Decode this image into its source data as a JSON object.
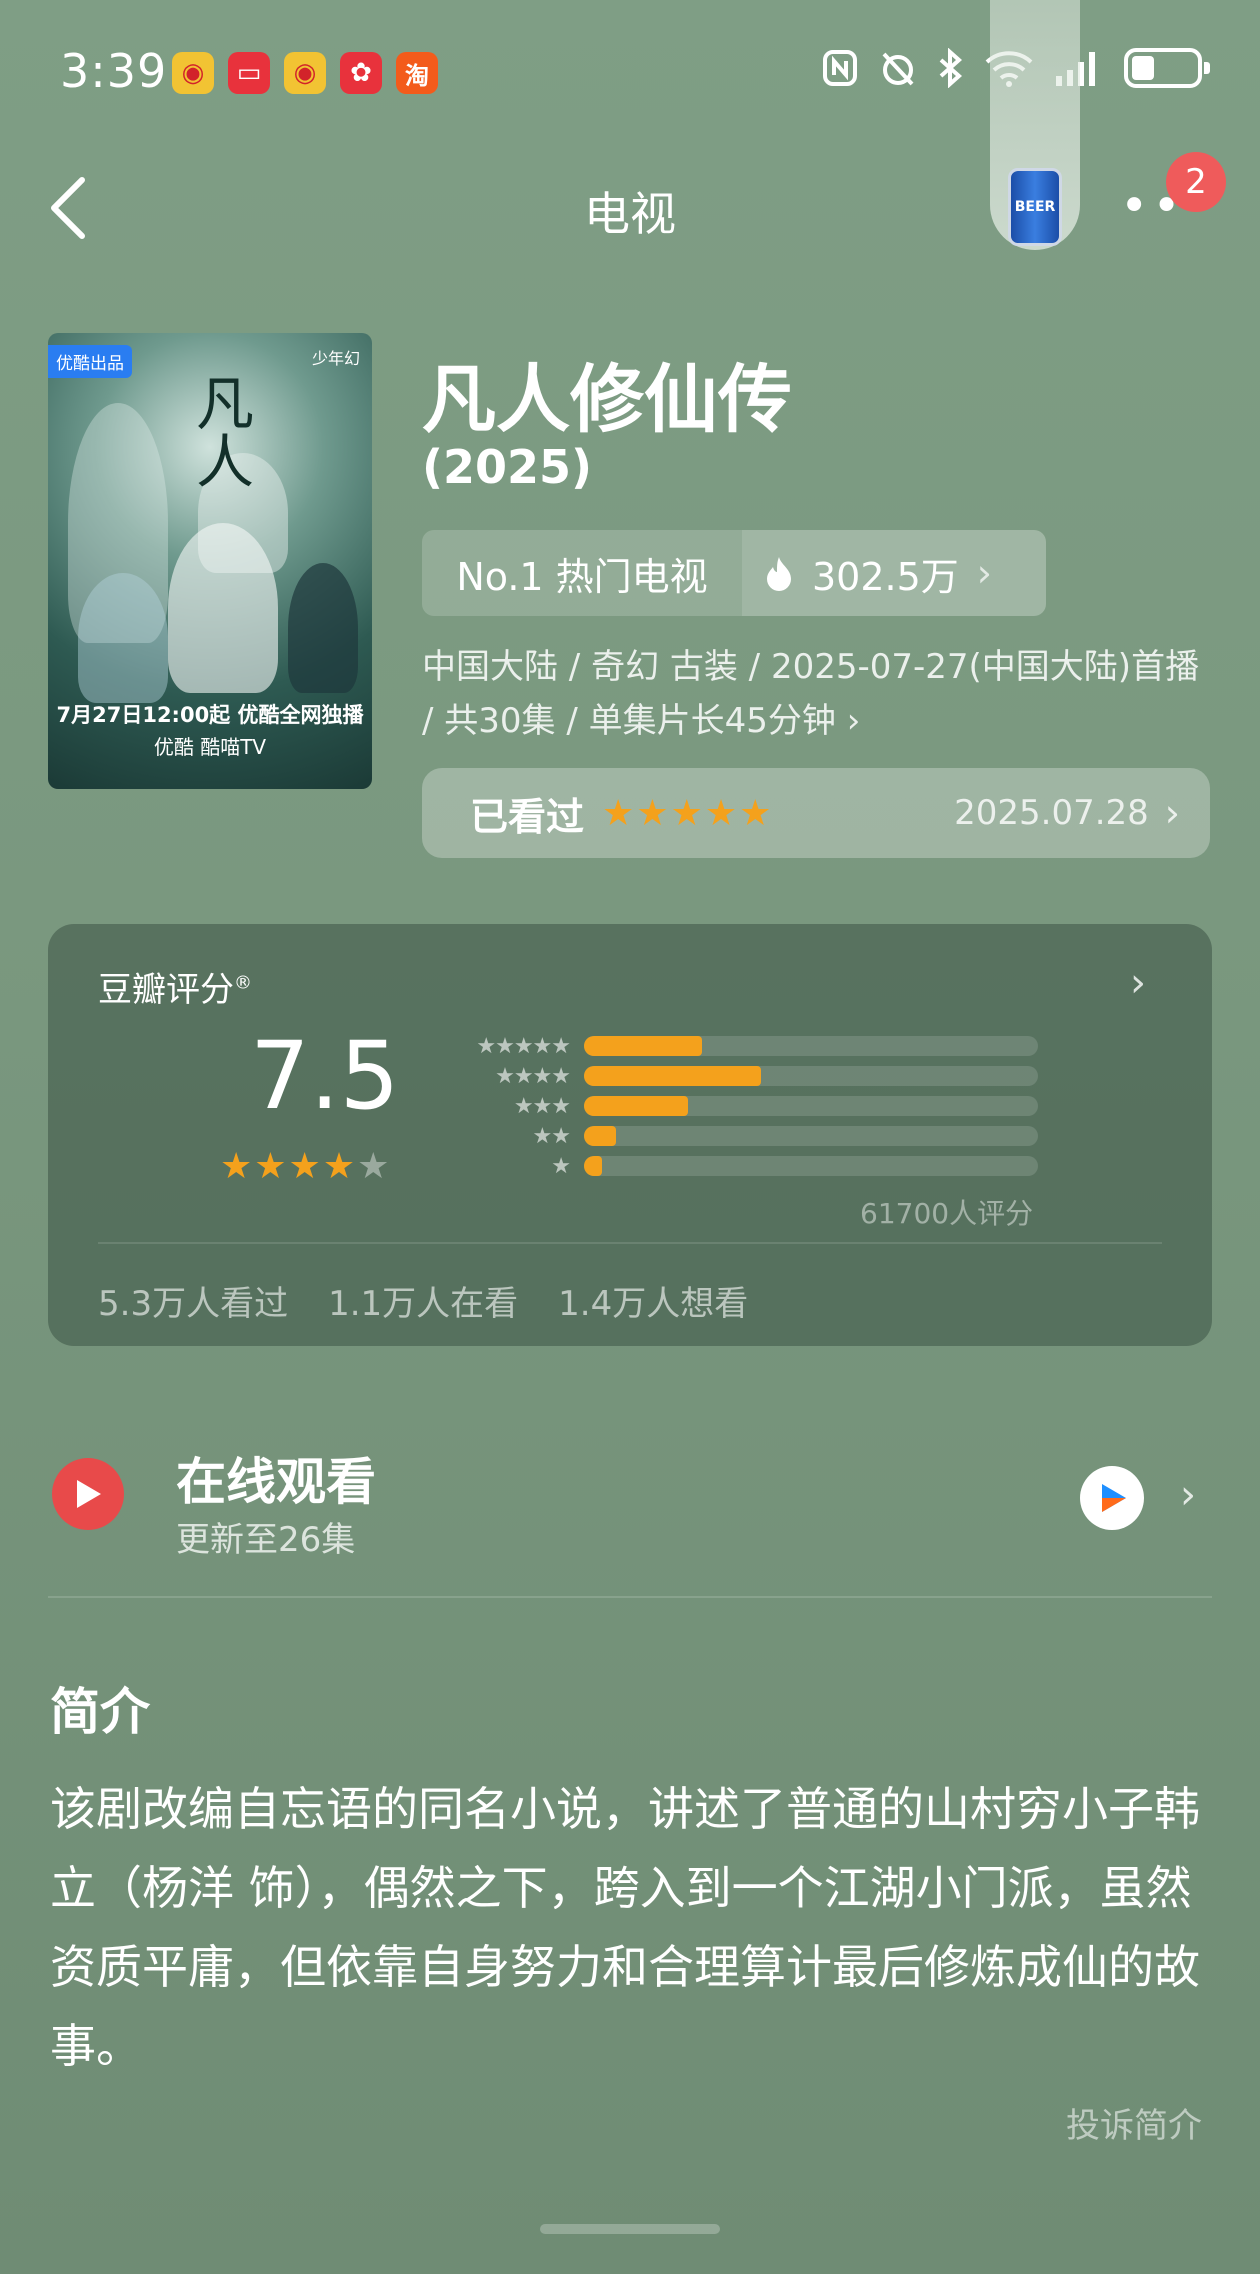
{
  "status_bar": {
    "time": "3:39",
    "apps": [
      {
        "name": "weibo-app-icon",
        "glyph": "微",
        "color": "#f2c333"
      },
      {
        "name": "red-book-app-icon",
        "glyph": "▢",
        "color": "#e8323c"
      },
      {
        "name": "weibo-app-icon-2",
        "glyph": "微",
        "color": "#f2c333"
      },
      {
        "name": "pinduoduo-app-icon",
        "glyph": "❖",
        "color": "#e8323c"
      },
      {
        "name": "taobao-app-icon",
        "glyph": "淘",
        "color": "#f35b1b"
      }
    ],
    "icons": [
      "nfc-icon",
      "alarm-icon",
      "bluetooth-icon",
      "wifi-icon",
      "signal-icon",
      "battery-icon"
    ]
  },
  "nav": {
    "title": "电视",
    "badge_count": "2"
  },
  "poster": {
    "tag": "优酷出品",
    "logo": "少年幻",
    "title": "凡人",
    "date_line": "7月27日12:00起 优酷全网独播",
    "platforms": "优酷  酷喵TV"
  },
  "show": {
    "title": "凡人修仙传",
    "year": "(2025)",
    "rank": "No.1 热门电视",
    "heat": "302.5万",
    "meta": "中国大陆 / 奇幻 古装 / 2025-07-27(中国大陆)首播 / 共30集 / 单集片长45分钟",
    "watched_label": "已看过",
    "watched_stars": "★★★★★",
    "watched_date": "2025.07.28"
  },
  "rating": {
    "title": "豆瓣评分",
    "score": "7.5",
    "stars_full": "★★★★",
    "stars_empty": "★",
    "distribution": [
      {
        "stars": "★★★★★",
        "fraction": 0.26
      },
      {
        "stars": "★★★★",
        "fraction": 0.39
      },
      {
        "stars": "★★★",
        "fraction": 0.23
      },
      {
        "stars": "★★",
        "fraction": 0.07
      },
      {
        "stars": "★",
        "fraction": 0.04
      }
    ],
    "count": "61700人评分",
    "watched": "5.3万人看过",
    "watching": "1.1万人在看",
    "want": "1.4万人想看"
  },
  "online": {
    "title": "在线观看",
    "subtitle": "更新至26集"
  },
  "synopsis": {
    "title": "简介",
    "body": "该剧改编自忘语的同名小说，讲述了普通的山村穷小子韩立（杨洋 饰），偶然之下，跨入到一个江湖小门派，虽然资质平庸，但依靠自身努力和合理算计最后修炼成仙的故事。",
    "report": "投诉简介"
  },
  "colors": {
    "background": "#7b9a80",
    "star_orange": "#f4a11c",
    "play_red": "#e84a4a",
    "badge_red": "#ef5b5b"
  }
}
